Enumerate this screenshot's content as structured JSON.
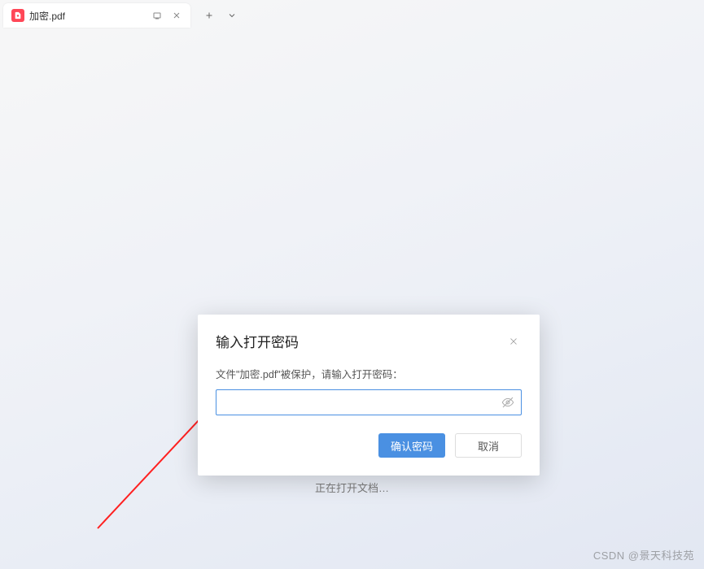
{
  "tab": {
    "title": "加密.pdf",
    "icon_name": "pdf-icon"
  },
  "background": {
    "loading_text": "正在打开文档…"
  },
  "dialog": {
    "title": "输入打开密码",
    "message": "文件\"加密.pdf\"被保护，请输入打开密码：",
    "password_value": "",
    "confirm_label": "确认密码",
    "cancel_label": "取消"
  },
  "watermark": "CSDN @景天科技苑"
}
